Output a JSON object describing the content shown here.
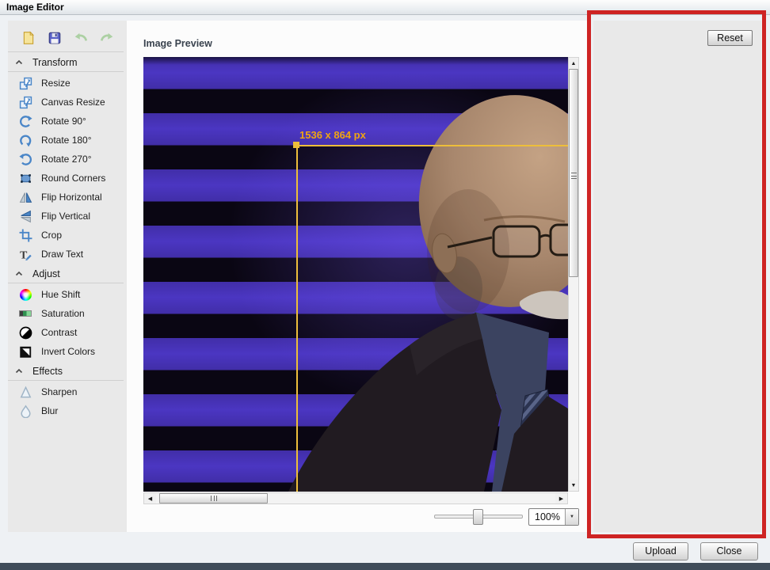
{
  "window": {
    "title": "Image Editor"
  },
  "toolbar": {
    "buttons": [
      {
        "icon": "new-file-icon"
      },
      {
        "icon": "save-icon"
      },
      {
        "icon": "undo-icon"
      },
      {
        "icon": "redo-icon"
      }
    ]
  },
  "sidebar": {
    "sections": [
      {
        "label": "Transform",
        "items": [
          {
            "icon": "resize-icon",
            "label": "Resize"
          },
          {
            "icon": "canvas-resize-icon",
            "label": "Canvas Resize"
          },
          {
            "icon": "rotate-90-icon",
            "label": "Rotate 90°"
          },
          {
            "icon": "rotate-180-icon",
            "label": "Rotate 180°"
          },
          {
            "icon": "rotate-270-icon",
            "label": "Rotate 270°"
          },
          {
            "icon": "round-corners-icon",
            "label": "Round Corners"
          },
          {
            "icon": "flip-horizontal-icon",
            "label": "Flip Horizontal"
          },
          {
            "icon": "flip-vertical-icon",
            "label": "Flip Vertical"
          },
          {
            "icon": "crop-icon",
            "label": "Crop"
          },
          {
            "icon": "draw-text-icon",
            "label": "Draw Text"
          }
        ]
      },
      {
        "label": "Adjust",
        "items": [
          {
            "icon": "hue-shift-icon",
            "label": "Hue Shift"
          },
          {
            "icon": "saturation-icon",
            "label": "Saturation"
          },
          {
            "icon": "contrast-icon",
            "label": "Contrast"
          },
          {
            "icon": "invert-colors-icon",
            "label": "Invert Colors"
          }
        ]
      },
      {
        "label": "Effects",
        "items": [
          {
            "icon": "sharpen-icon",
            "label": "Sharpen"
          },
          {
            "icon": "blur-icon",
            "label": "Blur"
          }
        ]
      }
    ]
  },
  "preview": {
    "title": "Image Preview",
    "crop_label": "1536 x 864 px"
  },
  "zoom_control": {
    "value": "100%"
  },
  "right_panel": {
    "reset_label": "Reset"
  },
  "footer": {
    "upload_label": "Upload",
    "close_label": "Close"
  },
  "colors": {
    "annotation_red": "#ce2424",
    "crop_line_yellow": "#edbe3a",
    "crop_text_orange": "#efa413",
    "stripe_purple": "#412ea8",
    "stripe_black": "#0a0613",
    "suit_black": "#211b21",
    "shirt_blue": "#3b4360"
  }
}
